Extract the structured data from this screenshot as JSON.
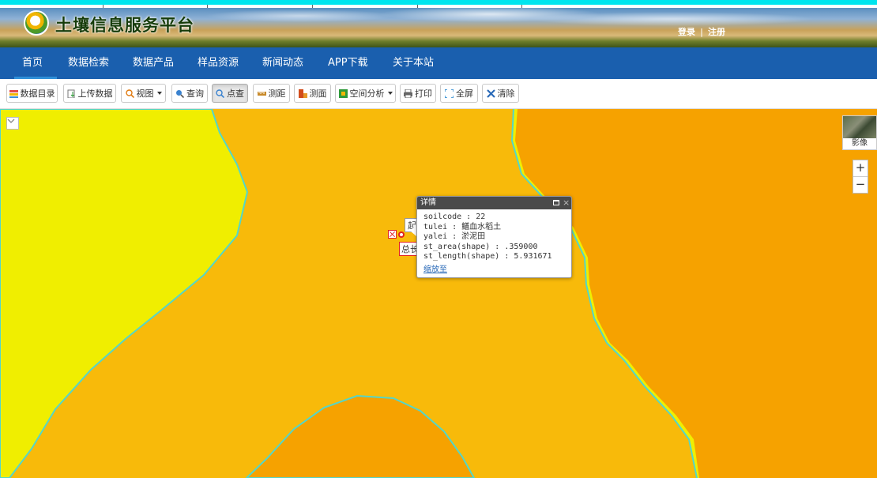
{
  "header": {
    "site_title": "土壤信息服务平台",
    "login": "登录",
    "separator": "|",
    "register": "注册"
  },
  "nav": {
    "items": [
      "首页",
      "数据检索",
      "数据产品",
      "样品资源",
      "新闻动态",
      "APP下载",
      "关于本站"
    ],
    "active_index": 0
  },
  "toolbar": {
    "buttons": [
      {
        "label": "数据目录",
        "icon": "layers-icon"
      },
      {
        "label": "上传数据",
        "icon": "upload-icon"
      },
      {
        "label": "视图",
        "icon": "view-icon",
        "dropdown": true
      },
      {
        "label": "查询",
        "icon": "query-icon"
      },
      {
        "label": "点查",
        "icon": "point-query-icon",
        "active": true
      },
      {
        "label": "测距",
        "icon": "ruler-icon"
      },
      {
        "label": "测面",
        "icon": "area-measure-icon"
      },
      {
        "label": "空间分析",
        "icon": "spatial-analysis-icon",
        "dropdown": true
      },
      {
        "label": "打印",
        "icon": "print-icon"
      },
      {
        "label": "全屏",
        "icon": "fullscreen-icon"
      },
      {
        "label": "清除",
        "icon": "clear-icon"
      }
    ]
  },
  "map": {
    "basemap_label": "影像",
    "zoom_in": "+",
    "zoom_out": "−",
    "collapse_symbol": "⌄",
    "measure_start": "起",
    "measure_total": "总长",
    "colors": {
      "light_zone": "#f0ee00",
      "mid_zone": "#f8ba0a",
      "dark_zone": "#f6a200",
      "boundary": "#55d6c8"
    }
  },
  "popup": {
    "title": "详情",
    "close_symbol": "×",
    "fields": [
      "soilcode : 22",
      "tulei : 鳝血水稻土",
      "yalei : 淤泥田",
      "st_area(shape) : .359000",
      "st_length(shape) : 5.931671"
    ],
    "zoom_link": "缩放至"
  }
}
